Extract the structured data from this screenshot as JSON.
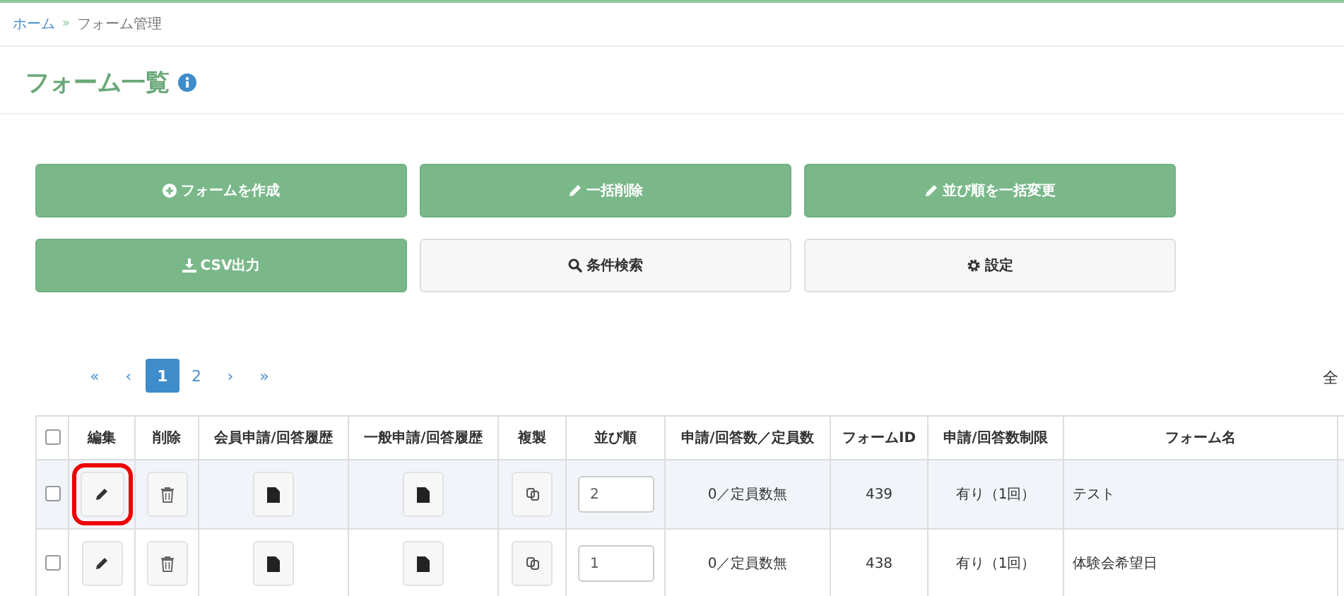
{
  "breadcrumb": [
    {
      "label": "ホーム",
      "link": true
    },
    {
      "label": "フォーム管理",
      "link": false
    }
  ],
  "breadcrumb_separator": "»",
  "page_title": "フォーム一覧",
  "action_buttons": [
    {
      "label": "フォームを作成",
      "kind": "add",
      "primary": true
    },
    {
      "label": "一括削除",
      "kind": "edit",
      "primary": true
    },
    {
      "label": "並び順を一括変更",
      "kind": "edit",
      "primary": true
    },
    {
      "label": "CSV出力",
      "kind": "export",
      "primary": true
    },
    {
      "label": "条件検索",
      "kind": "search",
      "primary": false
    },
    {
      "label": "設定",
      "kind": "settings",
      "primary": false
    }
  ],
  "pagination": {
    "first": "«",
    "prev": "‹",
    "pages": [
      {
        "label": "1",
        "selected": true
      },
      {
        "label": "2",
        "selected": false
      }
    ],
    "next": "›",
    "last": "»"
  },
  "total_label": "全",
  "table": {
    "select_all_checked": false,
    "columns": [
      "編集",
      "削除",
      "会員申請/回答履歴",
      "一般申請/回答履歴",
      "複製",
      "並び順",
      "申請/回答数／定員数",
      "フォームID",
      "申請/回答数制限",
      "フォーム名"
    ],
    "rows": [
      {
        "checked": false,
        "hovered": true,
        "highlighted": true,
        "order": "2",
        "count": "0／定員数無",
        "form_id": "439",
        "limit": "有り（1回）",
        "name": "テスト"
      },
      {
        "checked": false,
        "hovered": false,
        "highlighted": false,
        "order": "1",
        "count": "0／定員数無",
        "form_id": "438",
        "limit": "有り（1回）",
        "name": "体験会希望日"
      }
    ]
  }
}
